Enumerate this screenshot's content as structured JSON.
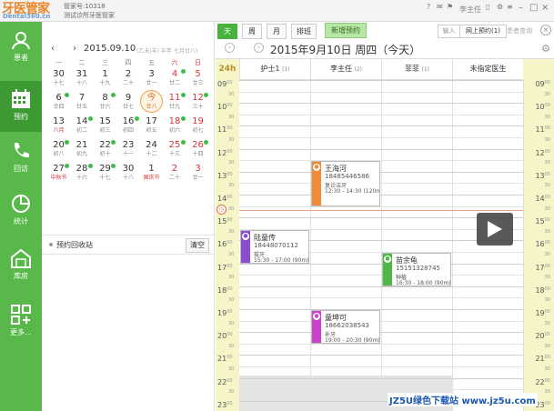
{
  "app": {
    "logo": "牙医管家",
    "logo_sub": "Dental360.cn",
    "account_label": "管家号:10318",
    "clinic": "测试诊所牙医管家",
    "user": "李主任"
  },
  "sidebar": [
    {
      "icon": "patient-icon",
      "label": "患者"
    },
    {
      "icon": "calendar-icon",
      "label": "预约"
    },
    {
      "icon": "phone-icon",
      "label": "回访"
    },
    {
      "icon": "pie-chart-icon",
      "label": "统计"
    },
    {
      "icon": "warehouse-icon",
      "label": "库房"
    },
    {
      "icon": "more-icon",
      "label": "更多..."
    }
  ],
  "calendar": {
    "date": "2015.09.10",
    "lunar": "(乙未(羊) 羊年 七月廿八)",
    "weekdays": [
      "一",
      "二",
      "三",
      "四",
      "五",
      "六",
      "日"
    ],
    "days": [
      {
        "n": "30",
        "l": "十七"
      },
      {
        "n": "31",
        "l": "十八"
      },
      {
        "n": "1",
        "l": "十九"
      },
      {
        "n": "2",
        "l": "二十"
      },
      {
        "n": "3",
        "l": "廿一"
      },
      {
        "n": "4",
        "l": "廿二",
        "dot": true
      },
      {
        "n": "5",
        "l": "廿三"
      },
      {
        "n": "6",
        "l": "廿四",
        "dot": true
      },
      {
        "n": "7",
        "l": "廿五"
      },
      {
        "n": "8",
        "l": "廿六",
        "dot": true
      },
      {
        "n": "9",
        "l": "廿七"
      },
      {
        "n": "今",
        "l": "廿八",
        "today": true
      },
      {
        "n": "11",
        "l": "廿九",
        "dot": true
      },
      {
        "n": "12",
        "l": "三十",
        "dot": true
      },
      {
        "n": "13",
        "l": "八月",
        "fest": true
      },
      {
        "n": "14",
        "l": "初二",
        "dot": true
      },
      {
        "n": "15",
        "l": "初三"
      },
      {
        "n": "16",
        "l": "初四",
        "dot": true
      },
      {
        "n": "17",
        "l": "初五"
      },
      {
        "n": "18",
        "l": "初六",
        "dot": true
      },
      {
        "n": "19",
        "l": "初七"
      },
      {
        "n": "20",
        "l": "初八",
        "dot": true
      },
      {
        "n": "21",
        "l": "初九"
      },
      {
        "n": "22",
        "l": "初十",
        "dot": true
      },
      {
        "n": "23",
        "l": "十一"
      },
      {
        "n": "24",
        "l": "十二"
      },
      {
        "n": "25",
        "l": "十三",
        "dot": true
      },
      {
        "n": "26",
        "l": "十四",
        "dot": true
      },
      {
        "n": "27",
        "l": "中秋节",
        "fest": true,
        "dot": true
      },
      {
        "n": "28",
        "l": "十六",
        "dot": true
      },
      {
        "n": "29",
        "l": "十七",
        "dot": true
      },
      {
        "n": "30",
        "l": "十八"
      },
      {
        "n": "1",
        "l": "国庆节",
        "fest": true
      },
      {
        "n": "2",
        "l": "二十"
      },
      {
        "n": "3",
        "l": "廿一"
      }
    ]
  },
  "recycle": {
    "label": "预约回收站",
    "clear": "清空"
  },
  "toolbar": {
    "tabs": [
      "天",
      "周",
      "月",
      "排班"
    ],
    "new_appt": "新增预约",
    "online_pre": "输入",
    "online": "网上预约(1)",
    "search": "患者查询"
  },
  "day_title": "2015年9月10日 周四（今天）",
  "hour_label": "24h",
  "columns": [
    {
      "name": "护士1",
      "count": "(1)"
    },
    {
      "name": "李主任",
      "count": "(2)"
    },
    {
      "name": "菲菲",
      "count": "(1)"
    },
    {
      "name": "未指定医生",
      "count": ""
    }
  ],
  "hours": [
    "09",
    "10",
    "11",
    "12",
    "13",
    "14",
    "15",
    "16",
    "17",
    "18",
    "19",
    "20",
    "21",
    "22",
    "23"
  ],
  "half": [
    "00",
    "30"
  ],
  "appointments": [
    {
      "name": "王海河",
      "phone": "18485446586",
      "type": "复诊洁牙",
      "time": "12:30 - 14:30 (120m",
      "color": "#f08b38"
    },
    {
      "name": "陆童传",
      "phone": "18448070112",
      "type": "拔牙",
      "time": "15:30 - 17:00 (90m)",
      "color": "#8c4bd1"
    },
    {
      "name": "苗余龟",
      "phone": "15151328745",
      "type": "种植",
      "time": "16:30 - 18:00 (90m)",
      "color": "#4fb848"
    },
    {
      "name": "童坤可",
      "phone": "18662038543",
      "type": "补牙",
      "time": "19:00 - 20:30 (90m)",
      "color": "#c944c9"
    }
  ],
  "watermark": "JZ5U绿色下载站 www.jz5u.com"
}
